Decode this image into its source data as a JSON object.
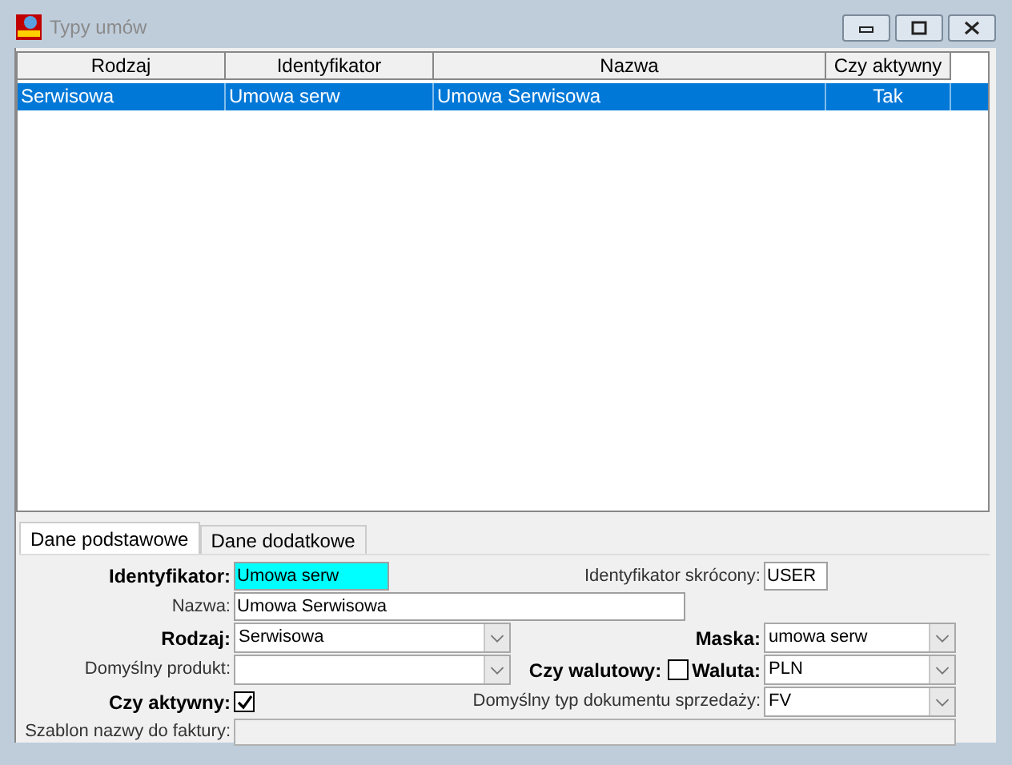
{
  "window": {
    "title": "Typy umów"
  },
  "table": {
    "columns": [
      "Rodzaj",
      "Identyfikator",
      "Nazwa",
      "Czy aktywny"
    ],
    "rows": [
      {
        "cells": [
          "Serwisowa",
          "Umowa serw",
          "Umowa Serwisowa",
          "Tak"
        ],
        "selected": true
      }
    ]
  },
  "tabs": [
    {
      "label": "Dane podstawowe",
      "selected": true
    },
    {
      "label": "Dane dodatkowe",
      "selected": false
    }
  ],
  "form": {
    "identyfikator": {
      "label": "Identyfikator:",
      "value": "Umowa serw"
    },
    "identyfikator_skrocony": {
      "label": "Identyfikator skrócony:",
      "value": "USER"
    },
    "nazwa": {
      "label": "Nazwa:",
      "value": "Umowa Serwisowa"
    },
    "rodzaj": {
      "label": "Rodzaj:",
      "value": "Serwisowa"
    },
    "maska": {
      "label": "Maska:",
      "value": "umowa serw"
    },
    "domyslny_produkt": {
      "label": "Domyślny produkt:"
    },
    "czy_walutowy": {
      "label": "Czy walutowy:",
      "checked": false
    },
    "waluta": {
      "label": "Waluta:",
      "value": "PLN"
    },
    "czy_aktywny": {
      "label": "Czy aktywny:",
      "checked": true
    },
    "domyslny_typ_dokumentu": {
      "label": "Domyślny typ dokumentu sprzedaży:",
      "value": "FV"
    },
    "szablon_nazwy": {
      "label": "Szablon nazwy do faktury:"
    }
  }
}
